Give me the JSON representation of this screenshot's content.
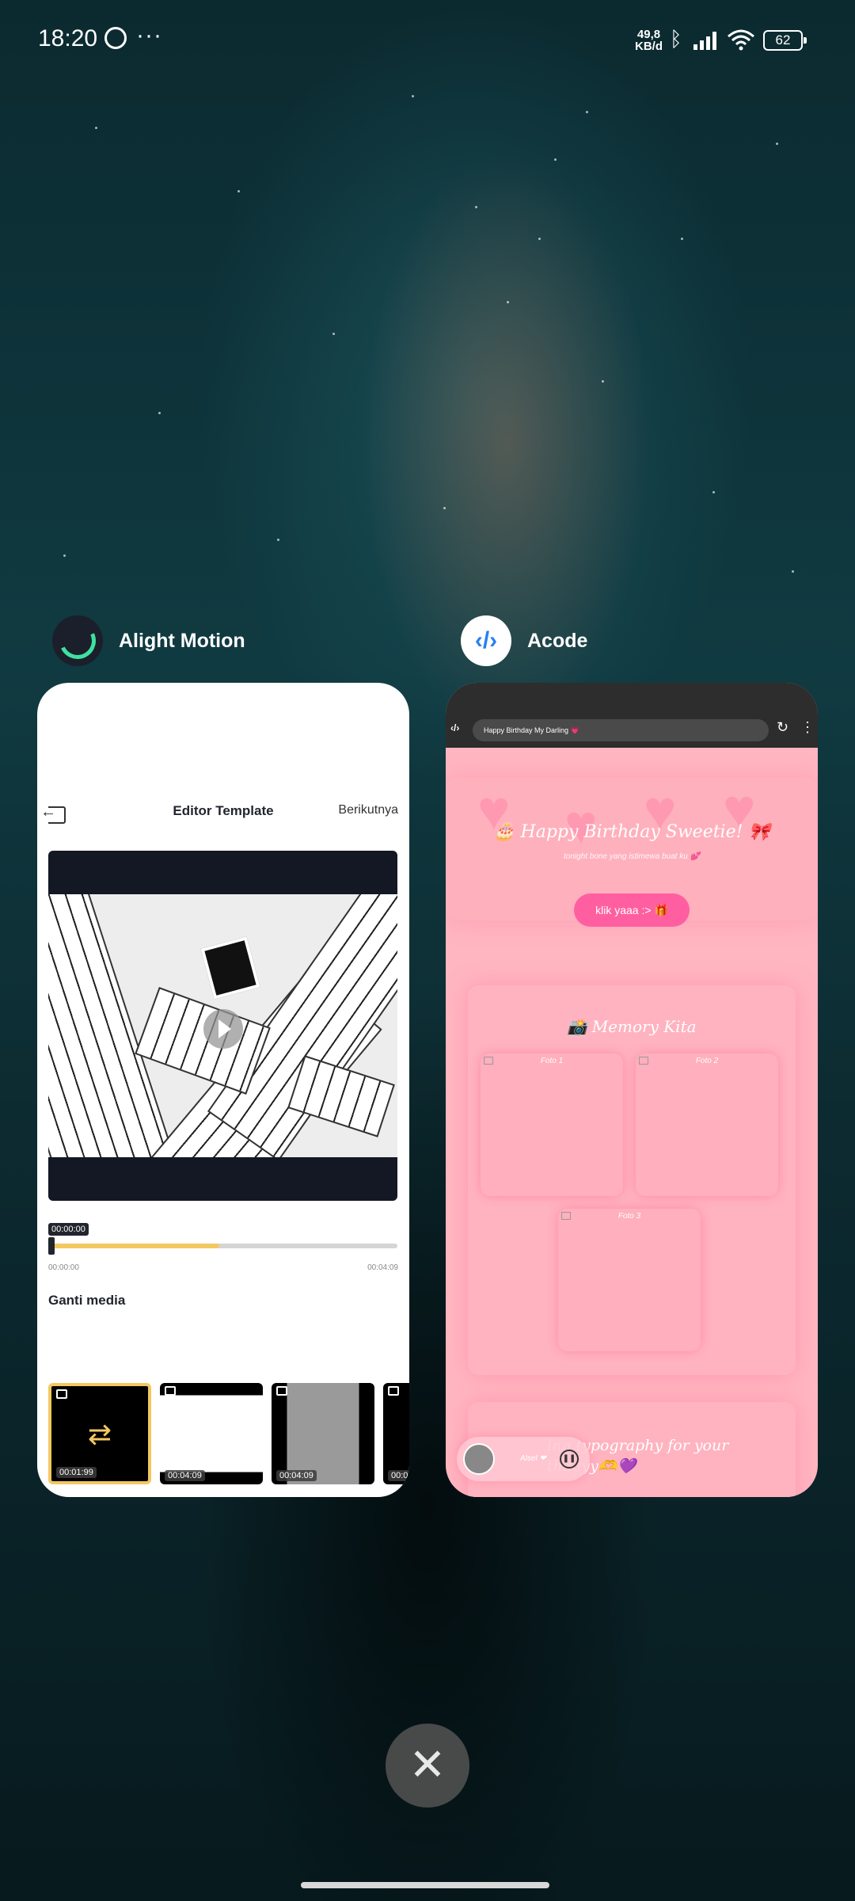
{
  "status_bar": {
    "time": "18:20",
    "more_indicator": "···",
    "net_speed_value": "49,8",
    "net_speed_unit": "KB/d",
    "battery": "62"
  },
  "recent_apps": [
    {
      "name": "Alight Motion",
      "icon": "alight-motion-icon",
      "screen": {
        "title": "Editor Template",
        "next_label": "Berikutnya",
        "timecode": "00:00:00",
        "progress_fraction": 0.49,
        "time_start": "00:00:00",
        "time_end": "00:04:09",
        "section_title": "Ganti media",
        "thumbnails": [
          {
            "duration": "00:01:99",
            "selected": true
          },
          {
            "duration": "00:04:09",
            "selected": false
          },
          {
            "duration": "00:04:09",
            "selected": false
          },
          {
            "duration": "00:0",
            "selected": false
          }
        ]
      }
    },
    {
      "name": "Acode",
      "icon": "acode-icon",
      "screen": {
        "url_title": "Happy Birthday My Darling 💗",
        "hero_title": "🎂 Happy Birthday Sweetie! 🎀",
        "hero_subtitle": "tonight bone yang istimewa buat ku 💕",
        "button_label": "klik yaaa :> 🎁",
        "memory_title": "📸 Memory Kita",
        "photos": [
          "Foto 1",
          "Foto 2",
          "Foto 3"
        ],
        "bottom_text_line1": "ing typography for your",
        "bottom_text_line2": "thdayy🫶💜",
        "player_label": "Alsel ❤"
      }
    }
  ],
  "close_label": "✕",
  "colors": {
    "accent_yellow": "#f3c861",
    "acode_pink": "#ffb6c1",
    "button_pink": "#ff5fa1"
  }
}
